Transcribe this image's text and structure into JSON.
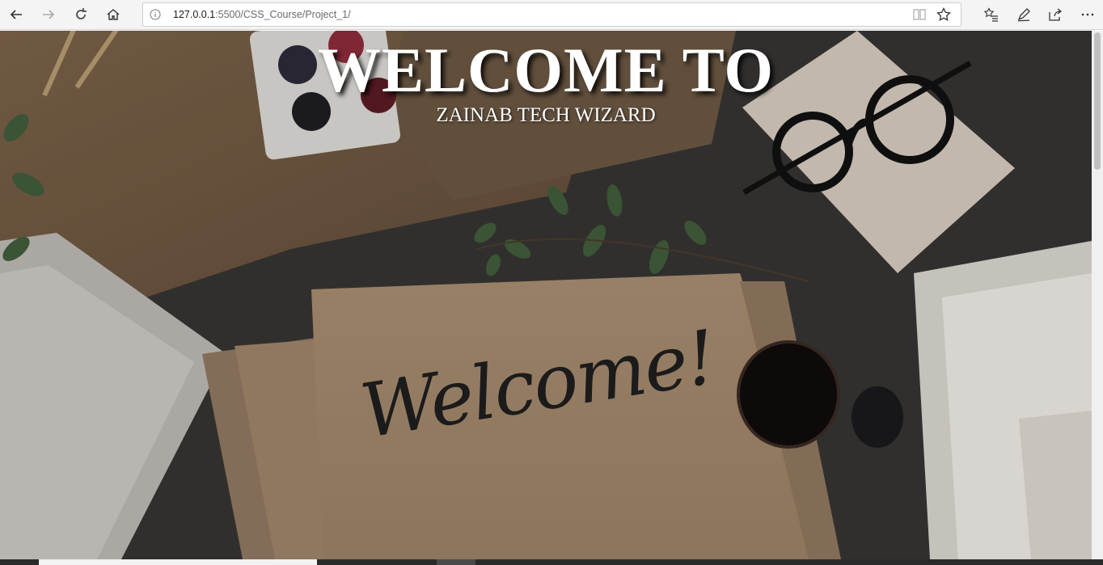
{
  "browser": {
    "url_host": "127.0.0.1",
    "url_path": ":5500/CSS_Course/Project_1/"
  },
  "icons": [
    "back-icon",
    "forward-icon",
    "refresh-icon",
    "home-icon",
    "info-icon",
    "reading-view-icon",
    "favorite-star-icon",
    "favorites-list-icon",
    "pen-icon",
    "share-icon",
    "more-icon"
  ],
  "page": {
    "title": "WELCOME TO",
    "subtitle": "ZAINAB TECH WIZARD",
    "background_script": "Welcome!"
  },
  "colors": {
    "title": "#ffffff",
    "kraft_paper": "#a78c6d",
    "slate": "#3a3835",
    "white_paper": "#d7d5d1"
  }
}
